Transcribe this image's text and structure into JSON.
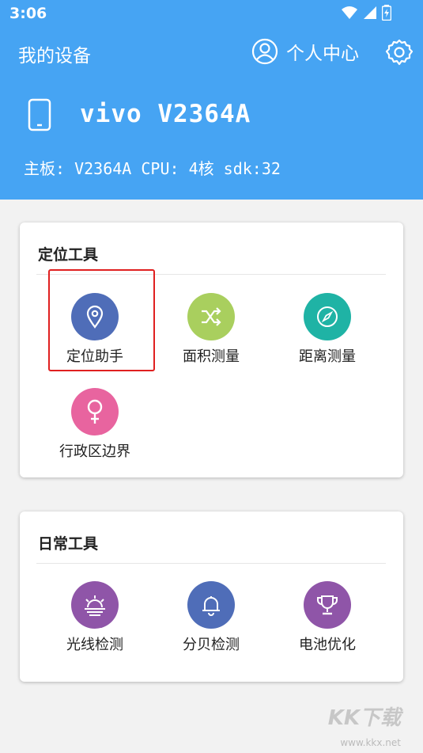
{
  "status_bar": {
    "time": "3:06",
    "icons": [
      "wifi-icon",
      "signal-icon",
      "battery-icon"
    ]
  },
  "header": {
    "title": "我的设备",
    "user_center_label": "个人中心",
    "device_name": "vivo V2364A",
    "device_info": "主板: V2364A CPU: 4核 sdk:32"
  },
  "cards": [
    {
      "title": "定位工具",
      "tools": [
        {
          "label": "定位助手",
          "icon": "location-pin-icon",
          "color": "#4f6db8"
        },
        {
          "label": "面积测量",
          "icon": "shuffle-icon",
          "color": "#a9cf5e"
        },
        {
          "label": "距离测量",
          "icon": "compass-icon",
          "color": "#1fb3a5"
        },
        {
          "label": "行政区边界",
          "icon": "female-symbol-icon",
          "color": "#e8649f"
        }
      ]
    },
    {
      "title": "日常工具",
      "tools": [
        {
          "label": "光线检测",
          "icon": "sunrise-icon",
          "color": "#8f55a8"
        },
        {
          "label": "分贝检测",
          "icon": "bell-icon",
          "color": "#4f6db8"
        },
        {
          "label": "电池优化",
          "icon": "trophy-icon",
          "color": "#8f55a8"
        }
      ]
    }
  ],
  "colors": {
    "header": "#46a4f3",
    "highlight": "#e02020",
    "background": "#f2f2f2"
  },
  "watermark": {
    "logo": "KK下载",
    "url": "www.kkx.net"
  }
}
